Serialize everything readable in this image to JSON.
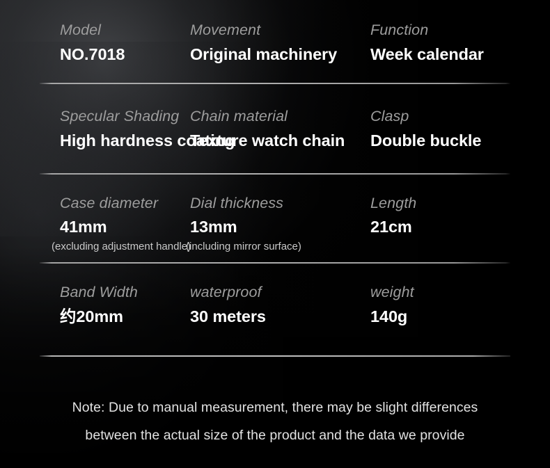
{
  "spec_table": {
    "rows": [
      {
        "row_name": "identity",
        "cells": [
          {
            "label": "Model",
            "value": "NO.7018",
            "sub": ""
          },
          {
            "label": "Movement",
            "value": "Original machinery",
            "sub": ""
          },
          {
            "label": "Function",
            "value": "Week calendar",
            "sub": ""
          }
        ]
      },
      {
        "row_name": "materials",
        "cells": [
          {
            "label": "Specular Shading",
            "value": "High hardness coating",
            "sub": ""
          },
          {
            "label": "Chain material",
            "value": "Texture watch chain",
            "sub": ""
          },
          {
            "label": "Clasp",
            "value": "Double buckle",
            "sub": ""
          }
        ]
      },
      {
        "row_name": "measurements",
        "cells": [
          {
            "label": "Case diameter",
            "value": "41mm",
            "sub": "(excluding adjustment handle)"
          },
          {
            "label": "Dial thickness",
            "value": "13mm",
            "sub": "(including mirror surface)"
          },
          {
            "label": "Length",
            "value": "21cm",
            "sub": ""
          }
        ]
      },
      {
        "row_name": "band-and-weight",
        "cells": [
          {
            "label": "Band Width",
            "value": "约20mm",
            "sub": ""
          },
          {
            "label": "waterproof",
            "value": "30 meters",
            "sub": ""
          },
          {
            "label": "weight",
            "value": "140g",
            "sub": ""
          }
        ]
      }
    ]
  },
  "note": {
    "line1": "Note: Due to manual measurement, there may be slight differences",
    "line2": "between the actual size of the product and the data we provide"
  },
  "colors": {
    "background": "#020202",
    "label_text": "#9d9d9d",
    "value_text": "#ffffff",
    "sub_text": "#c9c9c9",
    "note_text": "#e2e2e2",
    "divider": "#b7b7b7"
  }
}
